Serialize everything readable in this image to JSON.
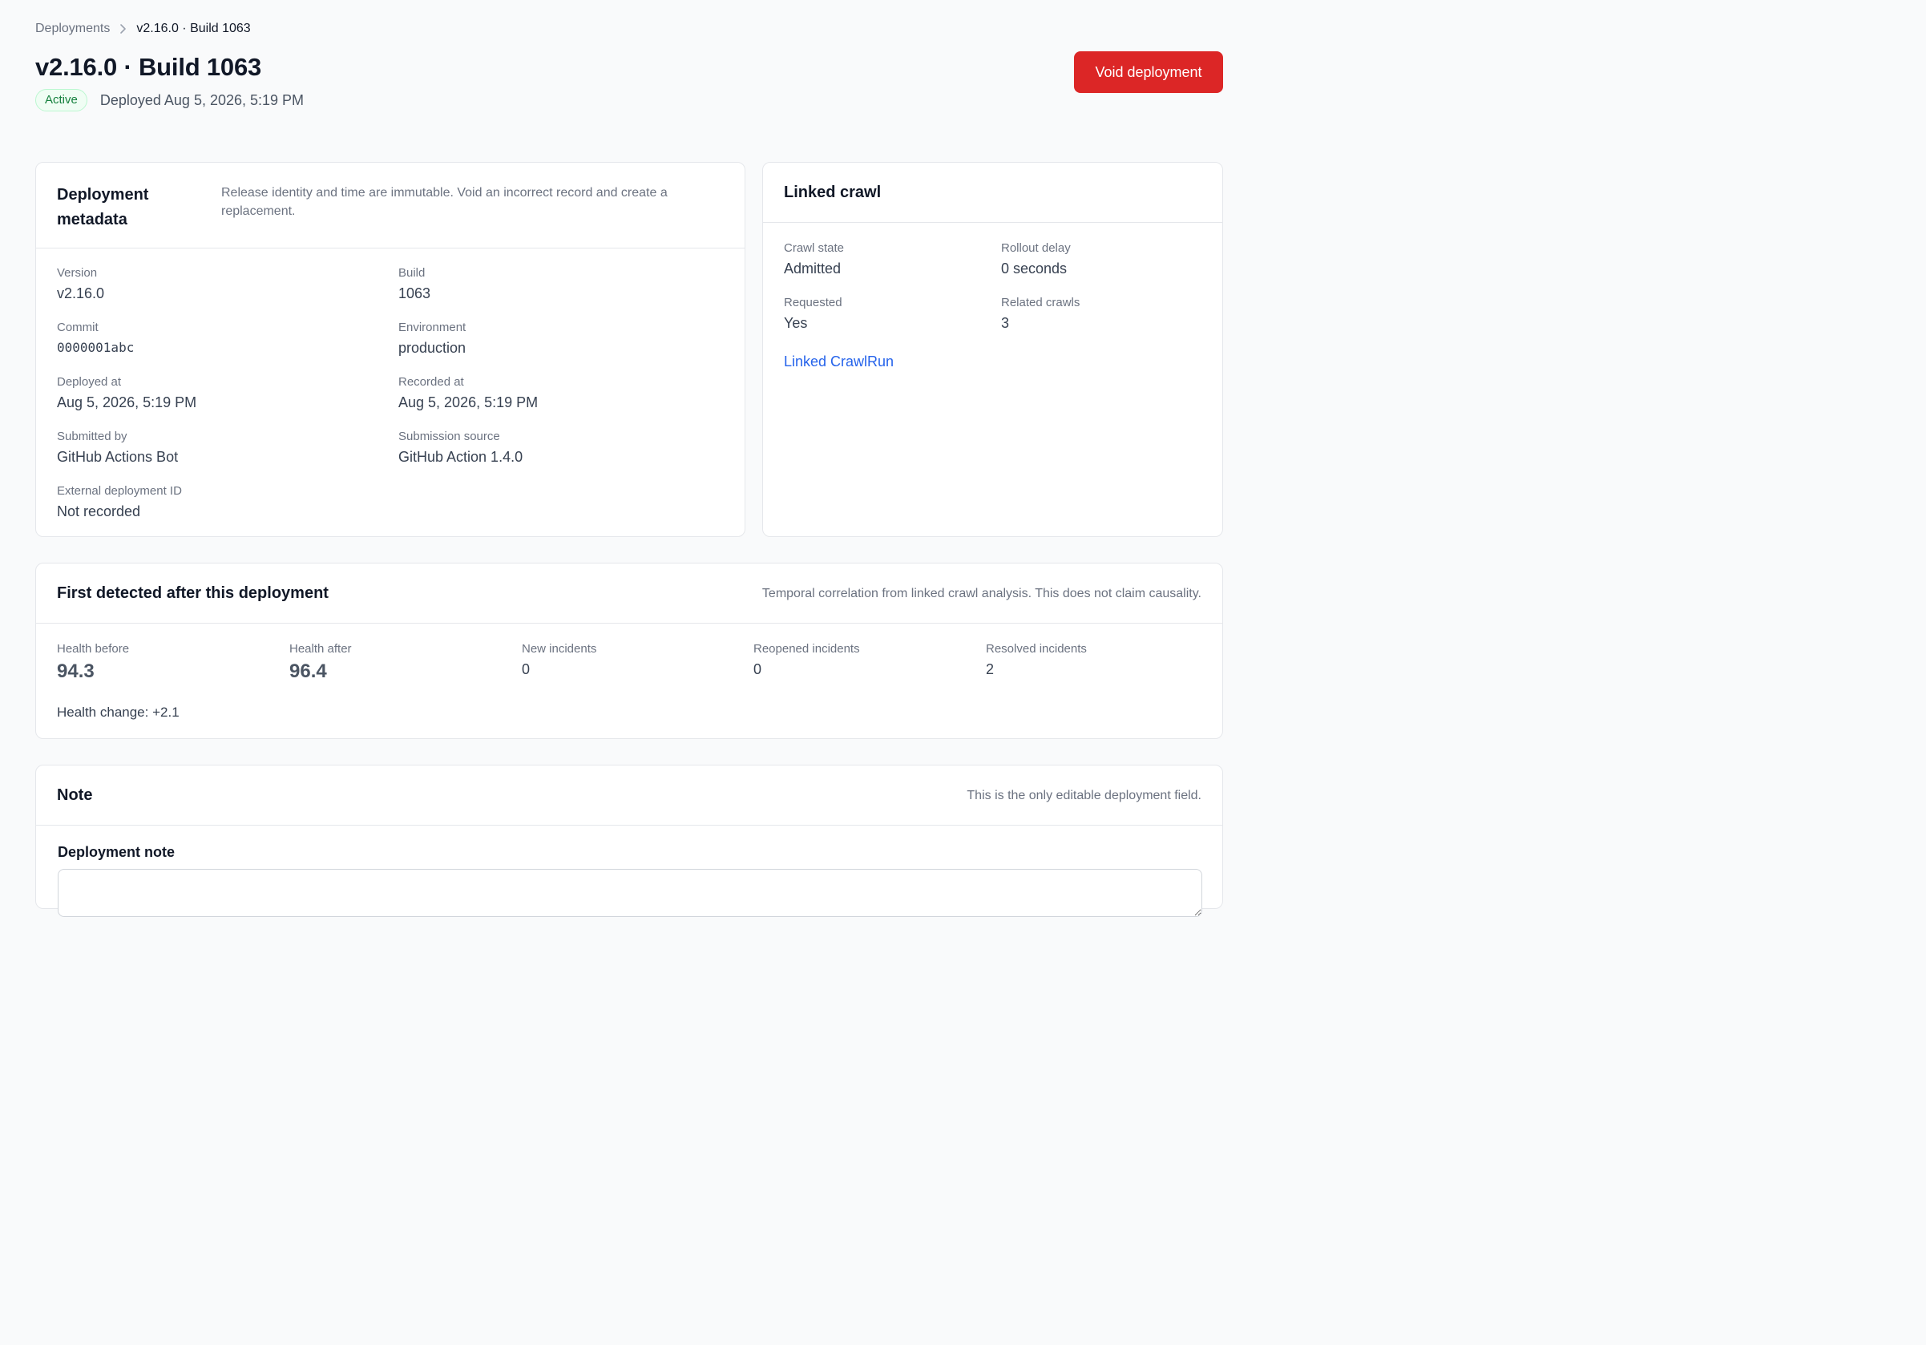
{
  "breadcrumb": {
    "parent": "Deployments",
    "current": "v2.16.0 · Build 1063"
  },
  "header": {
    "title": "v2.16.0 · Build 1063",
    "status": "Active",
    "deployed_text": "Deployed Aug 5, 2026, 5:19 PM",
    "void_label": "Void deployment"
  },
  "colors": {
    "danger": "#dc2626",
    "success": "#15803d",
    "link": "#2563eb"
  },
  "metadata": {
    "title": "Deployment metadata",
    "description": "Release identity and time are immutable. Void an incorrect record and create a replacement.",
    "fields": {
      "version": {
        "label": "Version",
        "value": "v2.16.0"
      },
      "build": {
        "label": "Build",
        "value": "1063"
      },
      "commit": {
        "label": "Commit",
        "value": "0000001abc"
      },
      "environment": {
        "label": "Environment",
        "value": "production"
      },
      "deployed_at": {
        "label": "Deployed at",
        "value": "Aug 5, 2026, 5:19 PM"
      },
      "recorded_at": {
        "label": "Recorded at",
        "value": "Aug 5, 2026, 5:19 PM"
      },
      "submitted_by": {
        "label": "Submitted by",
        "value": "GitHub Actions Bot"
      },
      "submission_source": {
        "label": "Submission source",
        "value": "GitHub Action 1.4.0"
      },
      "external_id": {
        "label": "External deployment ID",
        "value": "Not recorded"
      }
    }
  },
  "crawl": {
    "title": "Linked crawl",
    "fields": {
      "state": {
        "label": "Crawl state",
        "value": "Admitted"
      },
      "rollout_delay": {
        "label": "Rollout delay",
        "value": "0 seconds"
      },
      "requested": {
        "label": "Requested",
        "value": "Yes"
      },
      "related": {
        "label": "Related crawls",
        "value": "3"
      }
    },
    "link_label": "Linked CrawlRun"
  },
  "detected": {
    "title": "First detected after this deployment",
    "description": "Temporal correlation from linked crawl analysis. This does not claim causality.",
    "stats": {
      "health_before": {
        "label": "Health before",
        "value": "94.3"
      },
      "health_after": {
        "label": "Health after",
        "value": "96.4"
      },
      "new_incidents": {
        "label": "New incidents",
        "value": "0"
      },
      "reopened": {
        "label": "Reopened incidents",
        "value": "0"
      },
      "resolved": {
        "label": "Resolved incidents",
        "value": "2"
      }
    },
    "health_change": "Health change: +2.1"
  },
  "note": {
    "title": "Note",
    "description": "This is the only editable deployment field.",
    "field_label": "Deployment note"
  }
}
